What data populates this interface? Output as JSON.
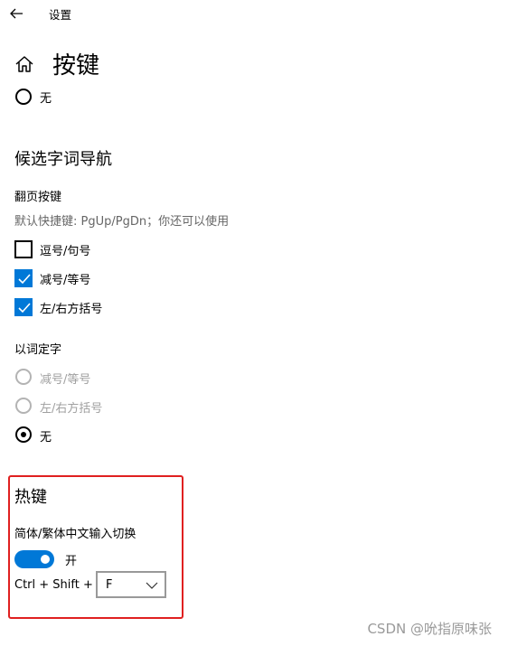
{
  "header": {
    "back_label": "←",
    "app_title": "设置"
  },
  "page": {
    "title": "按键"
  },
  "top_radio": {
    "label": "无"
  },
  "candidate_nav": {
    "title": "候选字词导航",
    "paging_title": "翻页按键",
    "paging_hint": "默认快捷键: PgUp/PgDn；你还可以使用",
    "options": [
      {
        "label": "逗号/句号",
        "checked": false
      },
      {
        "label": "减号/等号",
        "checked": true
      },
      {
        "label": "左/右方括号",
        "checked": true
      }
    ]
  },
  "word_select": {
    "title": "以词定字",
    "options": [
      {
        "label": "减号/等号",
        "selected": false,
        "disabled": true
      },
      {
        "label": "左/右方括号",
        "selected": false,
        "disabled": true
      },
      {
        "label": "无",
        "selected": true,
        "disabled": false
      }
    ]
  },
  "hotkeys": {
    "title": "热键",
    "toggle_label": "简体/繁体中文输入切换",
    "toggle_state": "开",
    "toggle_on": true,
    "shortcut_prefix": "Ctrl + Shift +",
    "shortcut_key": "F"
  },
  "watermark": "CSDN @吮指原味张",
  "colors": {
    "accent": "#0078d7",
    "highlight": "#e02020"
  }
}
